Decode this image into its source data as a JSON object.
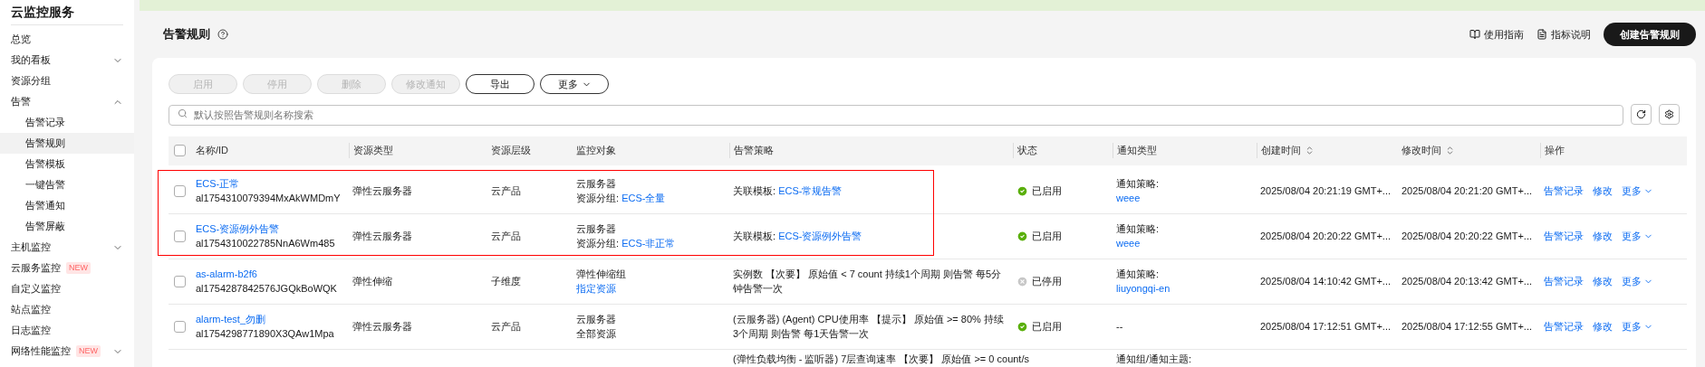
{
  "sidebar": {
    "title": "云监控服务",
    "items": [
      {
        "label": "总览",
        "selected": false
      },
      {
        "label": "我的看板",
        "selected": false,
        "expanded": false
      },
      {
        "label": "资源分组",
        "selected": false
      },
      {
        "label": "告警",
        "selected": false,
        "expanded": true,
        "children": [
          {
            "label": "告警记录",
            "selected": false
          },
          {
            "label": "告警规则",
            "selected": true
          },
          {
            "label": "告警模板",
            "selected": false
          },
          {
            "label": "一键告警",
            "selected": false
          },
          {
            "label": "告警通知",
            "selected": false
          },
          {
            "label": "告警屏蔽",
            "selected": false
          }
        ]
      },
      {
        "label": "主机监控",
        "selected": false,
        "expanded": false
      },
      {
        "label": "云服务监控",
        "selected": false,
        "badge": "NEW"
      },
      {
        "label": "自定义监控",
        "selected": false
      },
      {
        "label": "站点监控",
        "selected": false
      },
      {
        "label": "日志监控",
        "selected": false
      },
      {
        "label": "网络性能监控",
        "selected": false,
        "badge": "NEW",
        "expanded": false
      }
    ]
  },
  "page": {
    "title": "告警规则",
    "links": [
      "使用指南",
      "指标说明"
    ],
    "primary_button": "创建告警规则"
  },
  "toolbar": [
    {
      "label": "启用",
      "disabled": true
    },
    {
      "label": "停用",
      "disabled": true
    },
    {
      "label": "删除",
      "disabled": true
    },
    {
      "label": "修改通知",
      "disabled": true
    },
    {
      "label": "导出",
      "disabled": false
    },
    {
      "label": "更多",
      "disabled": false,
      "dropdown": true
    }
  ],
  "search": {
    "placeholder": "默认按照告警规则名称搜索"
  },
  "table": {
    "all_checked": false,
    "columns": [
      {
        "label": "名称/ID"
      },
      {
        "label": "资源类型"
      },
      {
        "label": "资源层级"
      },
      {
        "label": "监控对象"
      },
      {
        "label": "告警策略"
      },
      {
        "label": "状态"
      },
      {
        "label": "通知类型"
      },
      {
        "label": "创建时间",
        "sortable": true
      },
      {
        "label": "修改时间",
        "sortable": true
      },
      {
        "label": "操作"
      }
    ],
    "rows": [
      {
        "checked": false,
        "highlighted": true,
        "name": "ECS-正常",
        "id": "al1754310079394MxAkWMDmY",
        "resource_type": "弹性云服务器",
        "level": "云产品",
        "object": {
          "type": "云服务器",
          "label": "资源分组: ",
          "link": "ECS-全量"
        },
        "strategy": {
          "label": "关联模板: ",
          "link": "ECS-常规告警"
        },
        "status": {
          "text": "已启用",
          "on": true
        },
        "notify": {
          "label": "通知策略:",
          "link": "weee"
        },
        "created": "2025/08/04 20:21:19 GMT+...",
        "modified": "2025/08/04 20:21:20 GMT+...",
        "actions": [
          "告警记录",
          "修改",
          "更多"
        ]
      },
      {
        "checked": false,
        "highlighted": true,
        "name": "ECS-资源例外告警",
        "id": "al1754310022785NnA6Wm485",
        "resource_type": "弹性云服务器",
        "level": "云产品",
        "object": {
          "type": "云服务器",
          "label": "资源分组: ",
          "link": "ECS-非正常"
        },
        "strategy": {
          "label": "关联模板: ",
          "link": "ECS-资源例外告警"
        },
        "status": {
          "text": "已启用",
          "on": true
        },
        "notify": {
          "label": "通知策略:",
          "link": "weee"
        },
        "created": "2025/08/04 20:20:22 GMT+...",
        "modified": "2025/08/04 20:20:22 GMT+...",
        "actions": [
          "告警记录",
          "修改",
          "更多"
        ]
      },
      {
        "checked": false,
        "highlighted": false,
        "name": "as-alarm-b2f6",
        "id": "al1754287842576JGQkBoWQK",
        "resource_type": "弹性伸缩",
        "level": "子维度",
        "object": {
          "type": "弹性伸缩组",
          "link": "指定资源"
        },
        "strategy": {
          "text": "实例数 【次要】 原始值 < 7 count 持续1个周期 则告警 每5分钟告警一次"
        },
        "status": {
          "text": "已停用",
          "on": false
        },
        "notify": {
          "label": "通知策略:",
          "link": "liuyongqi-en"
        },
        "created": "2025/08/04 14:10:42 GMT+...",
        "modified": "2025/08/04 20:13:42 GMT+...",
        "actions": [
          "告警记录",
          "修改",
          "更多"
        ]
      },
      {
        "checked": false,
        "highlighted": false,
        "name": "alarm-test_勿删",
        "id": "al1754298771890X3QAw1Mpa",
        "resource_type": "弹性云服务器",
        "level": "云产品",
        "object": {
          "type": "云服务器",
          "text": "全部资源"
        },
        "strategy": {
          "text": "(云服务器) (Agent) CPU使用率 【提示】 原始值 >= 80% 持续3个周期 则告警 每1天告警一次"
        },
        "status": {
          "text": "已启用",
          "on": true
        },
        "notify": {
          "text": "--"
        },
        "created": "2025/08/04 17:12:51 GMT+...",
        "modified": "2025/08/04 17:12:55 GMT+...",
        "actions": [
          "告警记录",
          "修改",
          "更多"
        ]
      },
      {
        "strategy": {
          "text": "(弹性负载均衡 - 监听器) 7层查询速率 【次要】 原始值 >= 0 count/s"
        },
        "notify": {
          "label": "通知组/通知主题:"
        }
      }
    ]
  }
}
